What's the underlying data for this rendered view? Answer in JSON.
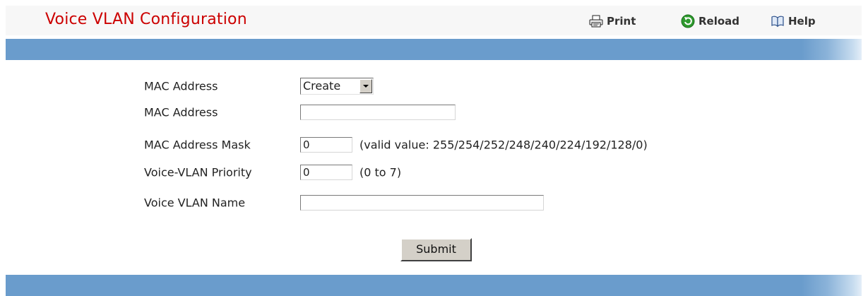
{
  "header": {
    "title": "Voice VLAN Configuration",
    "actions": {
      "print_label": "Print",
      "reload_label": "Reload",
      "help_label": "Help"
    }
  },
  "form": {
    "mac_select": {
      "label": "MAC Address",
      "selected": "Create"
    },
    "mac_address": {
      "label": "MAC Address",
      "value": ""
    },
    "mac_mask": {
      "label": "MAC Address Mask",
      "value": "0",
      "hint": "(valid value: 255/254/252/248/240/224/192/128/0)"
    },
    "priority": {
      "label": "Voice-VLAN Priority",
      "value": "0",
      "hint": "(0 to 7)"
    },
    "vlan_name": {
      "label": "Voice VLAN Name",
      "value": ""
    },
    "submit_label": "Submit"
  },
  "colors": {
    "title": "#cc0000",
    "bar": "#6a9ccc",
    "header_bg": "#f7f7f7",
    "button_face": "#d4d0c8"
  },
  "icons": [
    "printer-icon",
    "reload-icon",
    "help-book-icon"
  ]
}
